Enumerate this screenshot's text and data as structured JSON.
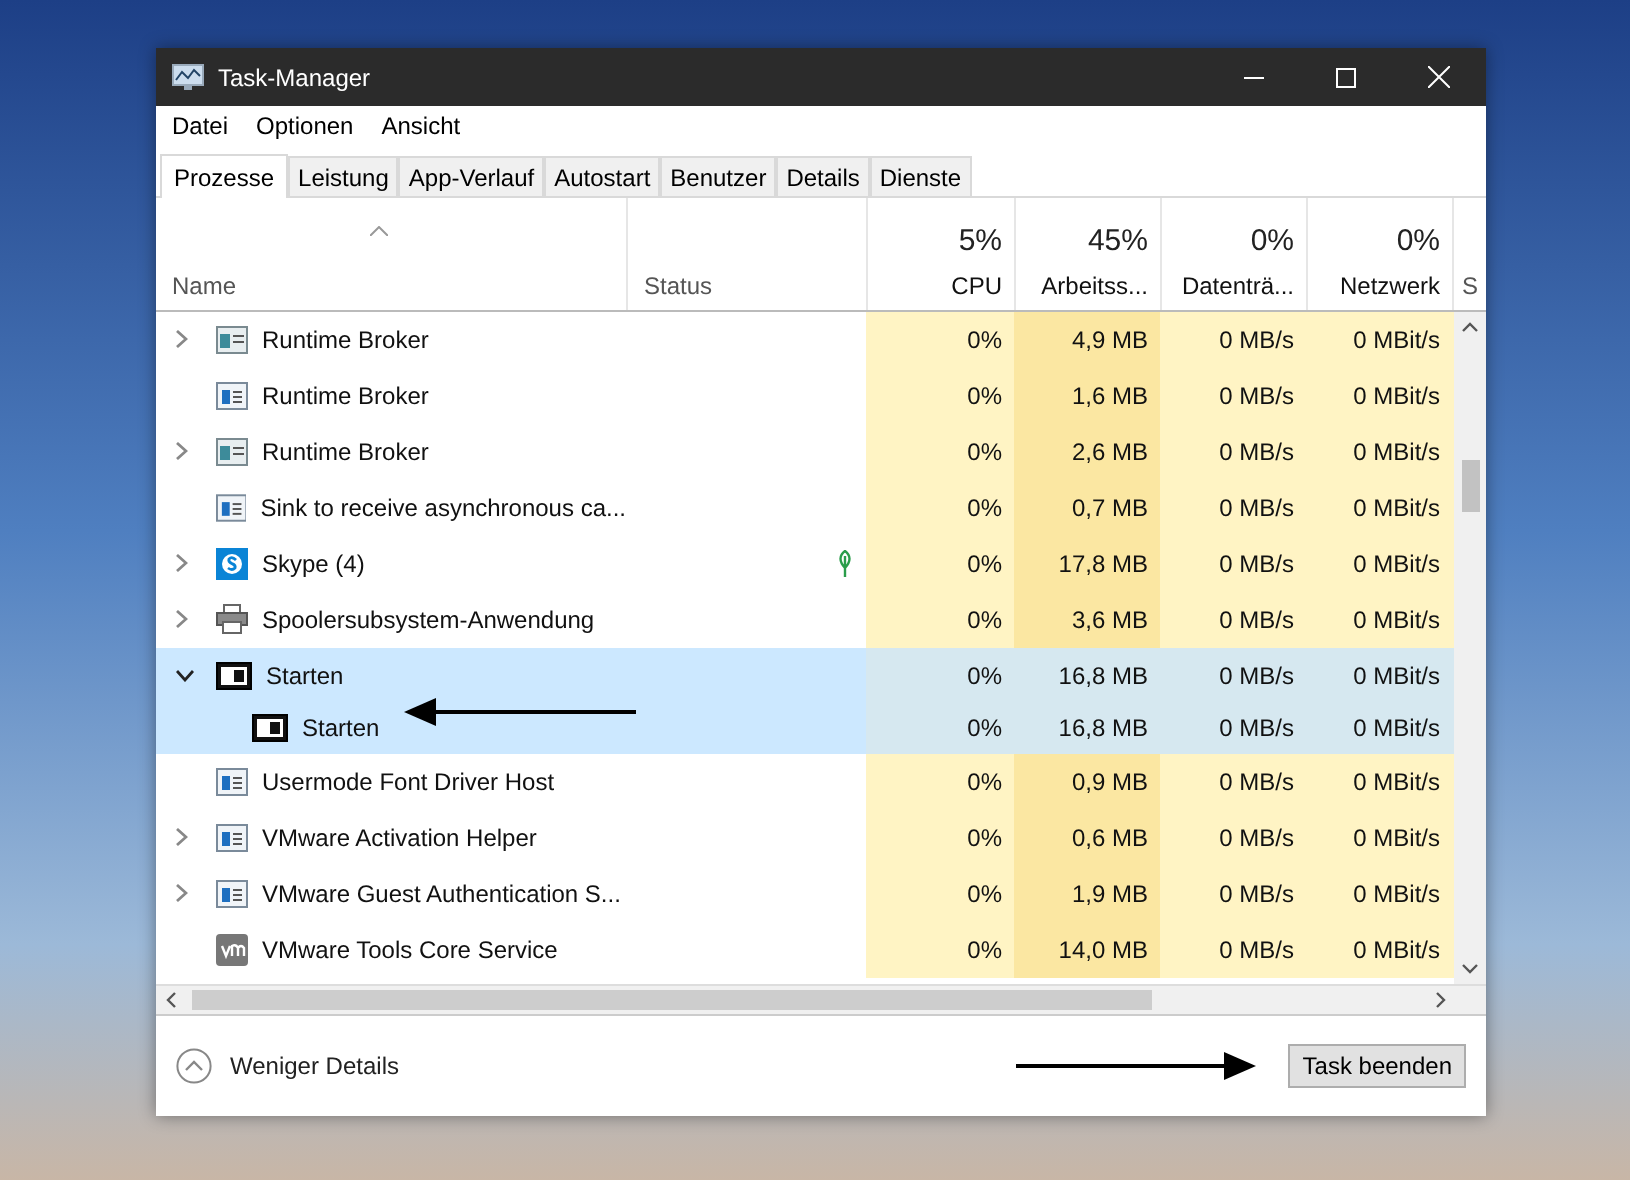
{
  "window": {
    "title": "Task-Manager"
  },
  "menu": [
    "Datei",
    "Optionen",
    "Ansicht"
  ],
  "tabs": [
    {
      "label": "Prozesse",
      "selected": true
    },
    {
      "label": "Leistung",
      "selected": false
    },
    {
      "label": "App-Verlauf",
      "selected": false
    },
    {
      "label": "Autostart",
      "selected": false
    },
    {
      "label": "Benutzer",
      "selected": false
    },
    {
      "label": "Details",
      "selected": false
    },
    {
      "label": "Dienste",
      "selected": false
    }
  ],
  "table": {
    "columns": [
      {
        "kind": "name",
        "label": "Name"
      },
      {
        "kind": "status",
        "label": "Status"
      },
      {
        "kind": "cpu",
        "label": "CPU",
        "total": "5%"
      },
      {
        "kind": "memory",
        "label": "Arbeitss...",
        "total": "45%"
      },
      {
        "kind": "disk",
        "label": "Datenträ...",
        "total": "0%"
      },
      {
        "kind": "network",
        "label": "Netzwerk",
        "total": "0%"
      },
      {
        "kind": "cut",
        "label": "S"
      }
    ],
    "rows": [
      {
        "name": "Runtime Broker",
        "kind": "window",
        "expandable": true,
        "expanded": false,
        "selected": false,
        "suspended": false,
        "cpu": "0%",
        "memory": "4,9 MB",
        "disk": "0 MB/s",
        "network": "0 MBit/s"
      },
      {
        "name": "Runtime Broker",
        "kind": "app",
        "expandable": false,
        "expanded": false,
        "selected": false,
        "suspended": false,
        "cpu": "0%",
        "memory": "1,6 MB",
        "disk": "0 MB/s",
        "network": "0 MBit/s"
      },
      {
        "name": "Runtime Broker",
        "kind": "window",
        "expandable": true,
        "expanded": false,
        "selected": false,
        "suspended": false,
        "cpu": "0%",
        "memory": "2,6 MB",
        "disk": "0 MB/s",
        "network": "0 MBit/s"
      },
      {
        "name": "Sink to receive asynchronous ca...",
        "kind": "app",
        "expandable": false,
        "expanded": false,
        "selected": false,
        "suspended": false,
        "cpu": "0%",
        "memory": "0,7 MB",
        "disk": "0 MB/s",
        "network": "0 MBit/s"
      },
      {
        "name": "Skype (4)",
        "kind": "skype",
        "expandable": true,
        "expanded": false,
        "selected": false,
        "suspended": true,
        "cpu": "0%",
        "memory": "17,8 MB",
        "disk": "0 MB/s",
        "network": "0 MBit/s"
      },
      {
        "name": "Spoolersubsystem-Anwendung",
        "kind": "printer",
        "expandable": true,
        "expanded": false,
        "selected": false,
        "suspended": false,
        "cpu": "0%",
        "memory": "3,6 MB",
        "disk": "0 MB/s",
        "network": "0 MBit/s"
      },
      {
        "name": "Starten",
        "kind": "dark",
        "expandable": true,
        "expanded": true,
        "selected": true,
        "suspended": false,
        "cpu": "0%",
        "memory": "16,8 MB",
        "disk": "0 MB/s",
        "network": "0 MBit/s",
        "children": [
          {
            "name": "Starten",
            "kind": "dark",
            "expandable": false,
            "expanded": false,
            "selected": true,
            "suspended": false,
            "cpu": "0%",
            "memory": "16,8 MB",
            "disk": "0 MB/s",
            "network": "0 MBit/s"
          }
        ]
      },
      {
        "name": "Usermode Font Driver Host",
        "kind": "app",
        "expandable": false,
        "expanded": false,
        "selected": false,
        "suspended": false,
        "cpu": "0%",
        "memory": "0,9 MB",
        "disk": "0 MB/s",
        "network": "0 MBit/s"
      },
      {
        "name": "VMware Activation Helper",
        "kind": "app",
        "expandable": true,
        "expanded": false,
        "selected": false,
        "suspended": false,
        "cpu": "0%",
        "memory": "0,6 MB",
        "disk": "0 MB/s",
        "network": "0 MBit/s"
      },
      {
        "name": "VMware Guest Authentication S...",
        "kind": "app",
        "expandable": true,
        "expanded": false,
        "selected": false,
        "suspended": false,
        "cpu": "0%",
        "memory": "1,9 MB",
        "disk": "0 MB/s",
        "network": "0 MBit/s"
      },
      {
        "name": "VMware Tools Core Service",
        "kind": "vm",
        "expandable": false,
        "expanded": false,
        "selected": false,
        "suspended": false,
        "cpu": "0%",
        "memory": "14,0 MB",
        "disk": "0 MB/s",
        "network": "0 MBit/s"
      }
    ]
  },
  "footer": {
    "details_label": "Weniger Details",
    "end_task_button": "Task beenden"
  }
}
